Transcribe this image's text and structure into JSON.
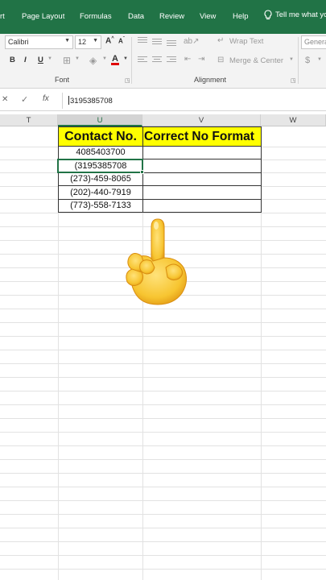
{
  "ribbon_tabs": [
    "rt",
    "Page Layout",
    "Formulas",
    "Data",
    "Review",
    "View",
    "Help"
  ],
  "tell_me": "Tell me what yo",
  "font": {
    "name": "Calibri",
    "size": "12",
    "group_label": "Font",
    "bold": "B",
    "italic": "I",
    "underline": "U",
    "grow": "A",
    "shrink": "A",
    "font_color": "A"
  },
  "alignment": {
    "wrap_text": "Wrap Text",
    "merge_center": "Merge & Center",
    "group_label": "Alignment"
  },
  "number": {
    "format": "Genera",
    "currency": "$"
  },
  "formula_bar": {
    "cancel": "✕",
    "enter": "✓",
    "fx": "fx",
    "value": "3195385708"
  },
  "columns": [
    "T",
    "U",
    "V",
    "W"
  ],
  "headers": {
    "contact": "Contact No.",
    "correct": "Correct No Format"
  },
  "contacts": [
    "4085403700",
    "(3195385708",
    "(273)-459-8065",
    "(202)-440-7919",
    "(773)-558-7133"
  ],
  "accent_color": "#217346",
  "header_fill": "#ffff00"
}
